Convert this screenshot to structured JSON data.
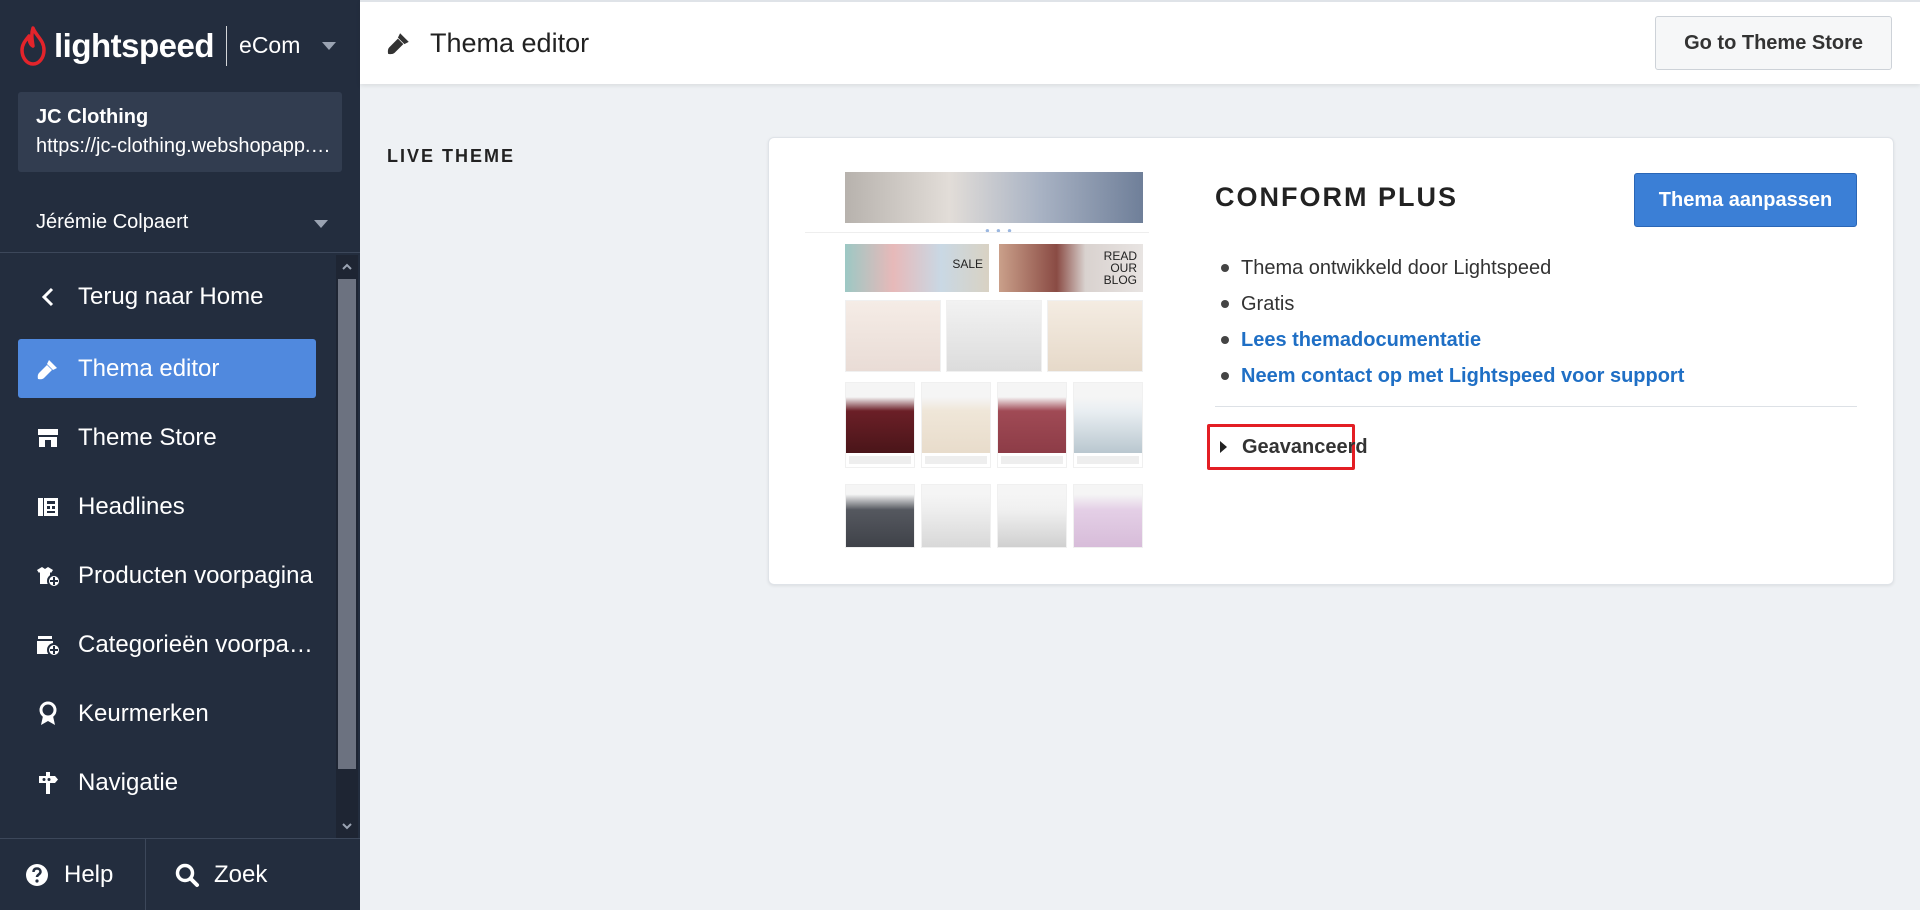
{
  "brand": {
    "name": "lightspeed",
    "product": "eCom",
    "accent": "#e3242b"
  },
  "shop": {
    "name": "JC Clothing",
    "url": "https://jc-clothing.webshopapp.com"
  },
  "user": {
    "name": "Jérémie Colpaert"
  },
  "sidebar": {
    "items": [
      {
        "label": "Terug naar Home",
        "icon": "chevron-left-icon"
      },
      {
        "label": "Thema editor",
        "icon": "brush-icon",
        "active": true
      },
      {
        "label": "Theme Store",
        "icon": "store-icon"
      },
      {
        "label": "Headlines",
        "icon": "newspaper-icon"
      },
      {
        "label": "Producten voorpagina",
        "icon": "product-frontpage-icon"
      },
      {
        "label": "Categorieën voorpagina",
        "icon": "category-frontpage-icon"
      },
      {
        "label": "Keurmerken",
        "icon": "badge-icon"
      },
      {
        "label": "Navigatie",
        "icon": "signpost-icon"
      }
    ],
    "active_color": "#5089de"
  },
  "bottom": {
    "help_label": "Help",
    "search_label": "Zoek"
  },
  "header": {
    "title": "Thema editor",
    "store_button": "Go to Theme Store"
  },
  "main": {
    "section_label": "LIVE THEME",
    "theme": {
      "name": "CONFORM PLUS",
      "customize_button": "Thema aanpassen",
      "features": [
        {
          "text": "Thema ontwikkeld door Lightspeed",
          "link": false
        },
        {
          "text": "Gratis",
          "link": false
        },
        {
          "text": "Lees themadocumentatie",
          "link": true
        },
        {
          "text": "Neem contact op met Lightspeed voor support",
          "link": true
        }
      ],
      "advanced_label": "Geavanceerd",
      "preview": {
        "sale_label": "SALE",
        "blog_label": "READ OUR BLOG"
      }
    }
  }
}
